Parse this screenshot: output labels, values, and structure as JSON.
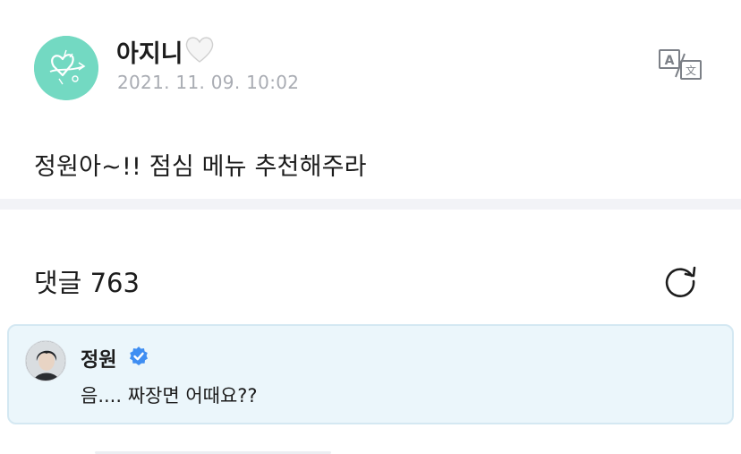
{
  "post": {
    "author": "아지니",
    "author_emoji_icon": "white-heart-icon",
    "date": "2021. 11. 09. 10:02",
    "body": "정원아~!! 점심 메뉴 추천해주라",
    "translate_icon": "translate-icon"
  },
  "comments": {
    "label": "댓글 763",
    "refresh_icon": "refresh-icon",
    "highlighted": {
      "author": "정원",
      "verified_icon": "verified-badge-icon",
      "text": "음.... 짜장면 어때요??"
    }
  },
  "colors": {
    "avatar_bg": "#73d9c2",
    "comment_bg": "#ebf6fb",
    "comment_border": "#d4e8f2",
    "verified": "#3f8ef2",
    "date_text": "#a9acb3",
    "divider": "#f2f3f7"
  }
}
